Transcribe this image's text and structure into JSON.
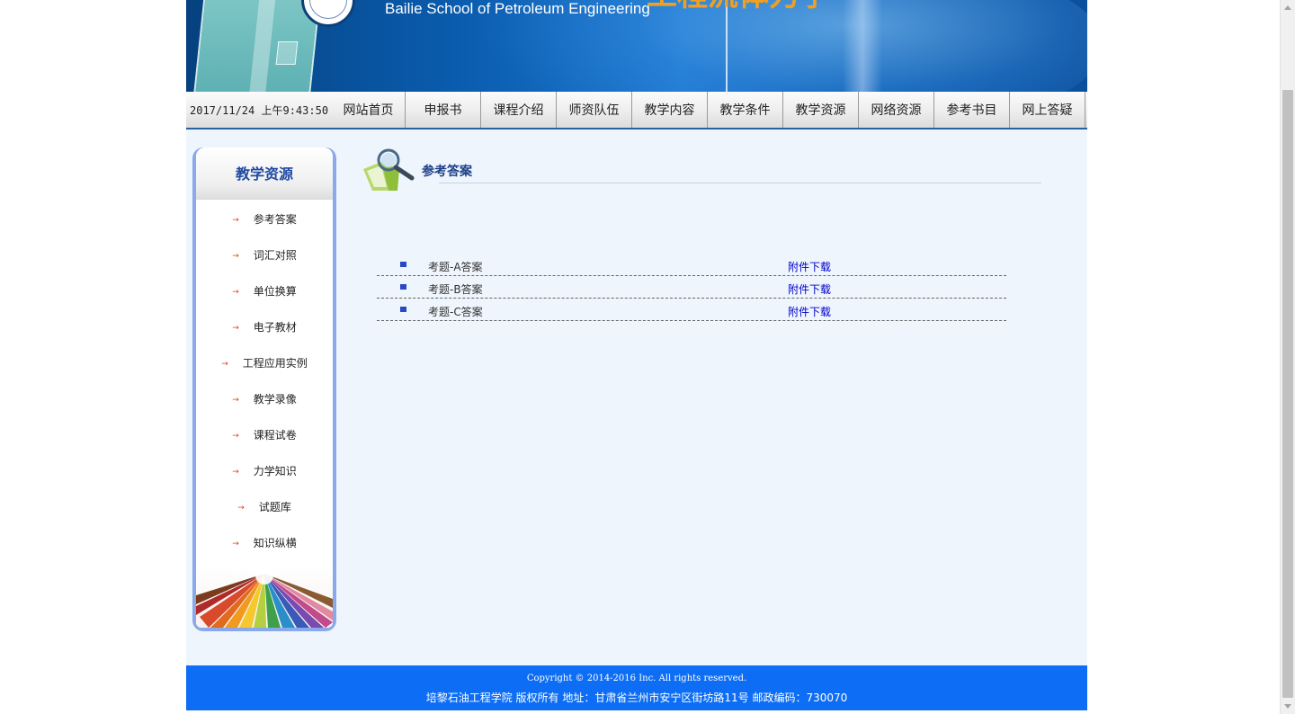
{
  "banner": {
    "school_name": "Bailie School of Petroleum Engineering",
    "title_partial": "工程流体力学"
  },
  "nav": {
    "datetime": "2017/11/24 上午9:43:50",
    "items": [
      {
        "label": "网站首页"
      },
      {
        "label": "申报书"
      },
      {
        "label": "课程介绍"
      },
      {
        "label": "师资队伍"
      },
      {
        "label": "教学内容"
      },
      {
        "label": "教学条件"
      },
      {
        "label": "教学资源"
      },
      {
        "label": "网络资源"
      },
      {
        "label": "参考书目"
      },
      {
        "label": "网上答疑"
      }
    ]
  },
  "sidebar": {
    "title": "教学资源",
    "arrow_glyph": "→",
    "items": [
      {
        "label": "参考答案"
      },
      {
        "label": "词汇对照"
      },
      {
        "label": "单位换算"
      },
      {
        "label": "电子教材"
      },
      {
        "label": "工程应用实例"
      },
      {
        "label": "教学录像"
      },
      {
        "label": "课程试卷"
      },
      {
        "label": "力学知识"
      },
      {
        "label": "试题库"
      },
      {
        "label": "知识纵横"
      }
    ]
  },
  "content": {
    "heading": "参考答案",
    "files": [
      {
        "name": "考题-A答案",
        "link": "附件下载"
      },
      {
        "name": "考题-B答案",
        "link": "附件下载"
      },
      {
        "name": "考题-C答案",
        "link": "附件下载"
      }
    ]
  },
  "footer": {
    "copyright": "Copyright © 2014-2016 Inc. All rights reserved.",
    "address": "培黎石油工程学院 版权所有 地址：甘肃省兰州市安宁区街坊路11号 邮政编码：730070"
  },
  "colors": {
    "nav_border": "#2a5fa0",
    "sidebar_frame": "#8aa9ea",
    "sidebar_title": "#1f4aa4",
    "link": "#0000cc",
    "footer_bg": "#0d6ef5",
    "content_bg": "#eef5fd"
  }
}
